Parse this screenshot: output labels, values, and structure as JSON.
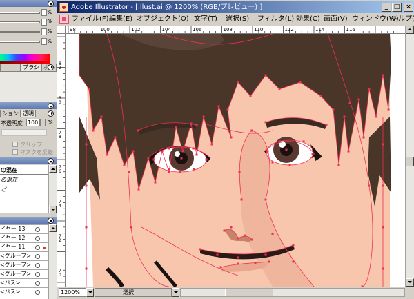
{
  "window": {
    "title": "Adobe Illustrator - [illust.ai @ 1200% (RGB/プレビュー) ]",
    "minimize": "_",
    "maximize": "□",
    "close": "×"
  },
  "menu": [
    "ファイル(F)",
    "編集(E)",
    "オブジェクト(O)",
    "文字(T)",
    "選択(S)",
    "フィルタ(L)",
    "効果(C)",
    "画面(V)",
    "ウィンドウ(W)",
    "ヘルプ(H)"
  ],
  "mdi": {
    "minimize": "_",
    "restore": "❐",
    "close": "×"
  },
  "ruler": {
    "top": [
      "98",
      "100",
      "102",
      "104",
      "106",
      "108",
      "110",
      "112",
      "114",
      "116"
    ],
    "left": [
      "82",
      "80",
      "78",
      "76",
      "74",
      "72",
      "70"
    ]
  },
  "color_palette": {
    "pct": [
      "%",
      "%",
      "%",
      "%"
    ]
  },
  "tabs_top": [
    "",
    "ブラシ",
    "ボル"
  ],
  "transparency": {
    "tabs": [
      "ション",
      "透明"
    ],
    "opacity_label": "不透明度",
    "opacity_value": "100",
    "opacity_unit": "%",
    "clip_label": "クリップ",
    "invert_mask_label": "マスクを反転"
  },
  "blend": {
    "title": "の混在",
    "mode": "の混在",
    "item": "ど"
  },
  "layers": [
    {
      "label": "イヤー 13",
      "target": false
    },
    {
      "label": "イヤー 12",
      "target": false
    },
    {
      "label": "イヤー 11",
      "target": true
    },
    {
      "label": "<グループ>",
      "target": false
    },
    {
      "label": "<グループ>",
      "target": false
    },
    {
      "label": "<グループ>",
      "target": false
    },
    {
      "label": "<パス>",
      "target": false
    },
    {
      "label": "<パス>",
      "target": false
    }
  ],
  "status": {
    "zoom": "1200%",
    "tool": "選択"
  },
  "colors": {
    "hair": "#4a3529",
    "skin": "#f7c6ad",
    "skin_shadow": "#e9a88f",
    "path": "#f03050",
    "title_start": "#0a246a",
    "title_end": "#a6caf0"
  }
}
